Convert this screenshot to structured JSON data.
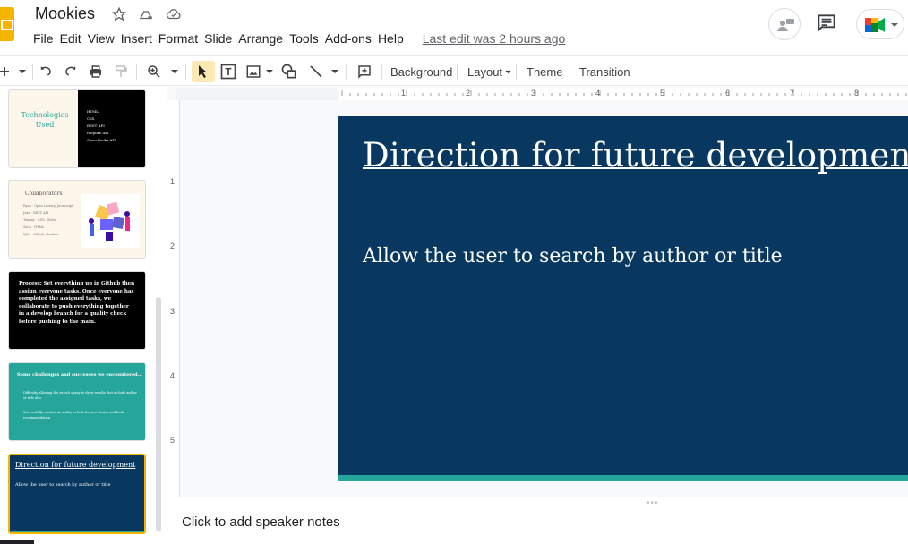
{
  "doc": {
    "title": "Mookies"
  },
  "menu": [
    {
      "label": "File"
    },
    {
      "label": "Edit"
    },
    {
      "label": "View"
    },
    {
      "label": "Insert"
    },
    {
      "label": "Format"
    },
    {
      "label": "Slide"
    },
    {
      "label": "Arrange"
    },
    {
      "label": "Tools"
    },
    {
      "label": "Add-ons"
    },
    {
      "label": "Help"
    }
  ],
  "last_edit": "Last edit was 2 hours ago",
  "toolbar": {
    "background_label": "Background",
    "layout_label": "Layout",
    "theme_label": "Theme",
    "transition_label": "Transition"
  },
  "icons": {
    "star": "star-icon",
    "move": "move-to-drive-icon",
    "cloud": "cloud-status-icon",
    "comments": "comment-icon",
    "meet": "meet-icon",
    "presenter": "presenter-icon"
  },
  "ruler": {
    "h_numbers": [
      "1",
      "2",
      "3",
      "4",
      "5",
      "6",
      "7",
      "8"
    ],
    "v_numbers": [
      "1",
      "2",
      "3",
      "4",
      "5"
    ]
  },
  "thumbnails": {
    "t1": {
      "title": "Technologies Used",
      "bullets": [
        "HTML",
        "CSS",
        "REST API",
        "Require API",
        "Open Books API"
      ]
    },
    "t2": {
      "title": "Collaborators",
      "lines": [
        "Ryan - Open Library, Javascript",
        "Jake - REST API",
        "Tommy - CSS, Slides",
        "Zach - HTML",
        "Kyle - Github, Readme"
      ]
    },
    "t3": {
      "text": "Process: Set everything up in Github then assign everyone tasks. Once everyone has completed the assigned tasks, we collaborate to push everything together in a develop branch for a quality check before pushing to the main."
    },
    "t4": {
      "title": "Some challenges and successes we encountered...",
      "bullets": [
        "Difficulty allowing the search query to show results that include author or title also",
        "Successfully created an ability to look for new stories and book recommendation"
      ]
    },
    "t5": {
      "title": "Direction for future development",
      "body": "Allow the user to search by author or title"
    }
  },
  "slide": {
    "title": "Direction for future development",
    "body": "Allow the user to search by author or title"
  },
  "notes": {
    "placeholder": "Click to add speaker notes"
  },
  "colors": {
    "slide_bg": "#083860",
    "slide_band": "#26a69a",
    "accent_yellow": "#f4b400",
    "thumb_cream": "#fdf6ea",
    "thumb_teal": "#26a69a"
  }
}
